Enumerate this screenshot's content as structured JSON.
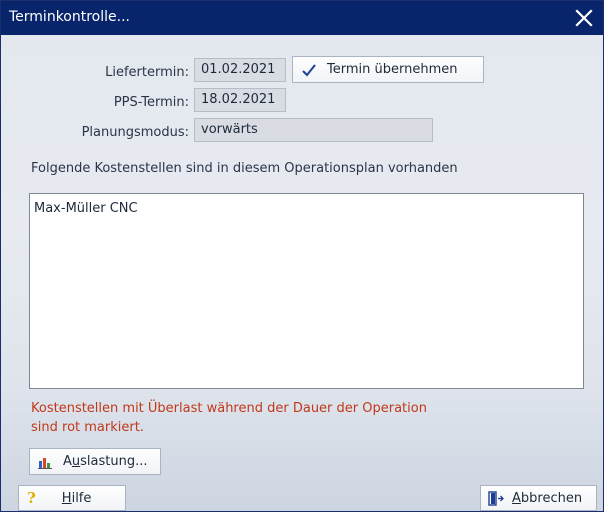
{
  "window": {
    "title": "Terminkontrolle...",
    "close_icon": "close-icon"
  },
  "form": {
    "liefertermin_label": "Liefertermin:",
    "liefertermin_value": "01.02.2021",
    "termin_button_label": "Termin übernehmen",
    "pps_label": "PPS-Termin:",
    "pps_value": "18.02.2021",
    "planungsmodus_label": "Planungsmodus:",
    "planungsmodus_value": "vorwärts"
  },
  "kostenstellen": {
    "heading": "Folgende Kostenstellen sind in diesem Operationsplan vorhanden",
    "items": [
      "Max-Müller CNC"
    ],
    "warning": "Kostenstellen mit Überlast während der Dauer der Operation sind rot markiert."
  },
  "buttons": {
    "auslastung_prefix": "A",
    "auslastung_underlined": "u",
    "auslastung_suffix": "slastung...",
    "hilfe_underlined": "H",
    "hilfe_suffix": "ilfe",
    "abbrechen_underlined": "A",
    "abbrechen_suffix": "bbrechen"
  },
  "icons": {
    "checkmark": "checkmark-icon",
    "chart": "bar-chart-icon",
    "help": "question-icon",
    "exit": "door-exit-icon"
  },
  "colors": {
    "titlebar": "#08256b",
    "warning_text": "#c0391b",
    "checkmark": "#1c3f94"
  }
}
